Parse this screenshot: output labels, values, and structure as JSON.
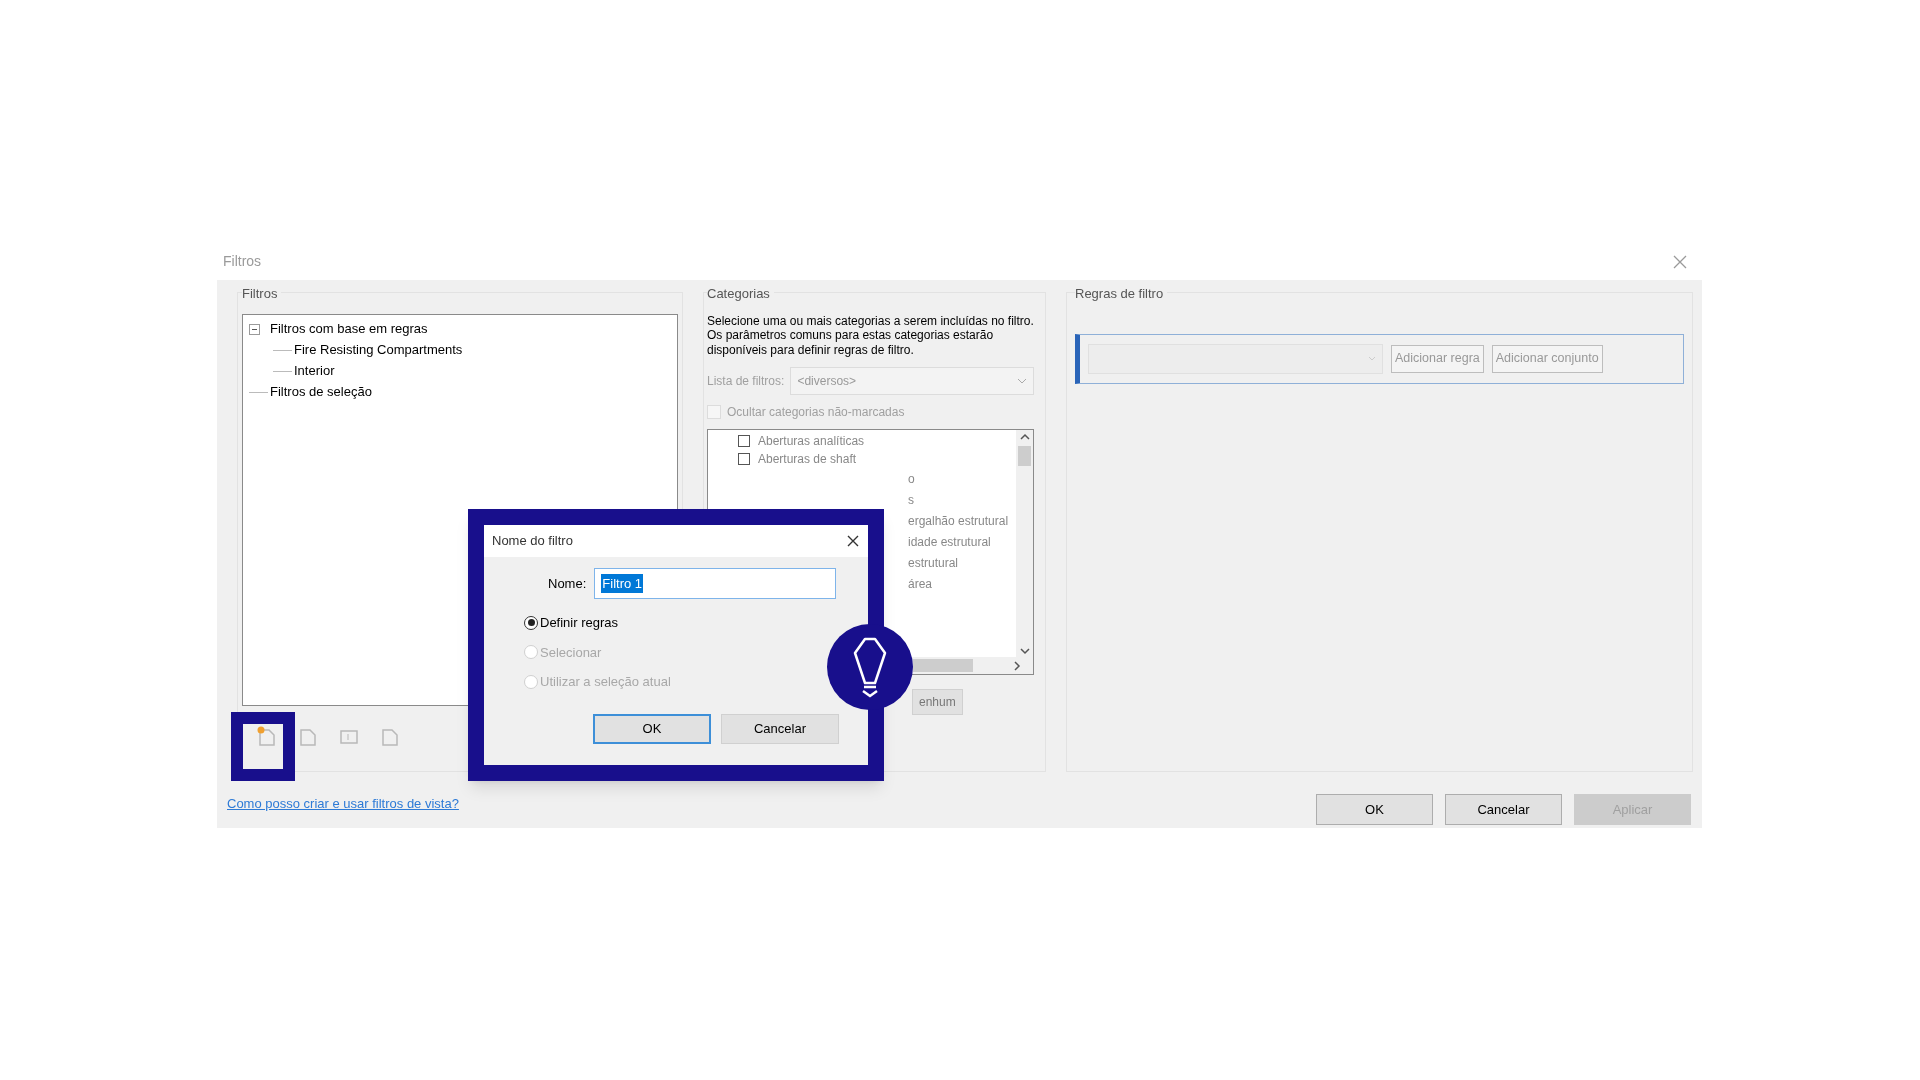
{
  "window": {
    "title": "Filtros"
  },
  "filters_panel": {
    "title": "Filtros",
    "tree": [
      {
        "label": "Filtros com base em regras",
        "expanded": true,
        "children": [
          {
            "label": "Fire Resisting Compartments"
          },
          {
            "label": "Interior"
          }
        ]
      },
      {
        "label": "Filtros de seleção"
      }
    ]
  },
  "categories_panel": {
    "title": "Categorias",
    "description": "Selecione uma ou mais categorias a serem incluídas no filtro. Os parâmetros comuns para estas categorias estarão disponíveis para definir regras de filtro.",
    "filter_list": {
      "label": "Lista de filtros:",
      "value": "<diversos>",
      "disabled": true
    },
    "hide_unchecked": {
      "label": "Ocultar categorias não-marcadas",
      "checked": false,
      "disabled": true
    },
    "items": [
      {
        "kind": "full",
        "label": "Aberturas analíticas",
        "checked": false
      },
      {
        "kind": "full",
        "label": "Aberturas de shaft",
        "checked": false
      },
      {
        "kind": "partial",
        "label": "o"
      },
      {
        "kind": "partial",
        "label": "s"
      },
      {
        "kind": "partial",
        "label": "ergalhão estrutural"
      },
      {
        "kind": "partial",
        "label": "idade estrutural"
      },
      {
        "kind": "partial",
        "label": "estrutural"
      },
      {
        "kind": "partial",
        "label": "área"
      }
    ],
    "partial_button": "enhum"
  },
  "rules_panel": {
    "title": "Regras de filtro",
    "buttons": [
      "Adicionar regra",
      "Adicionar conjunto"
    ]
  },
  "help_link": "Como posso criar e usar filtros de vista?",
  "buttons": [
    {
      "label": "OK",
      "disabled": false
    },
    {
      "label": "Cancelar",
      "disabled": false
    },
    {
      "label": "Aplicar",
      "disabled": true
    }
  ],
  "name_dialog": {
    "title": "Nome do filtro",
    "name_label": "Nome:",
    "name_value": "Filtro 1",
    "options": [
      {
        "label": "Definir regras",
        "selected": true,
        "disabled": false
      },
      {
        "label": "Selecionar",
        "selected": false,
        "disabled": true
      },
      {
        "label": "Utilizar a seleção atual",
        "selected": false,
        "disabled": true
      }
    ],
    "buttons": [
      {
        "label": "OK",
        "default": true
      },
      {
        "label": "Cancelar",
        "default": false
      }
    ]
  }
}
